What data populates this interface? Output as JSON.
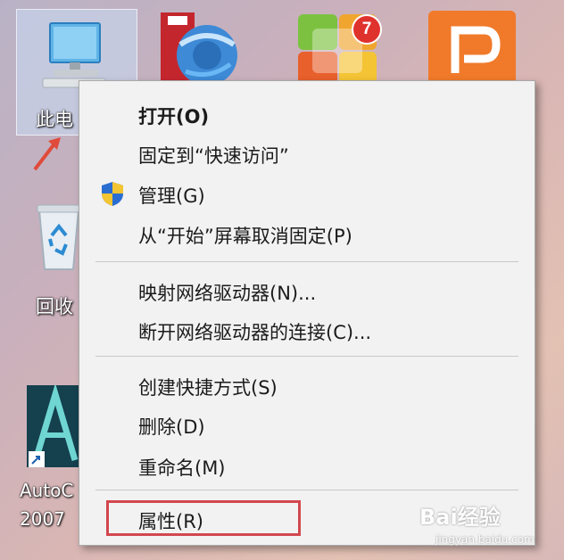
{
  "desktop": {
    "icons": [
      {
        "name": "this-pc",
        "label": "此电"
      },
      {
        "name": "ie-browser",
        "label": ""
      },
      {
        "name": "app-store",
        "label": "",
        "badge": "7"
      },
      {
        "name": "wps-presentation",
        "label": ""
      },
      {
        "name": "recycle-bin",
        "label": "回收"
      },
      {
        "name": "autocad",
        "label_line1": "AutoC",
        "label_line2": "2007"
      }
    ]
  },
  "context_menu": {
    "items": [
      {
        "label": "打开(O)",
        "bold": true
      },
      {
        "label": "固定到“快速访问”"
      },
      {
        "label": "管理(G)",
        "icon": "uac-shield-icon"
      },
      {
        "label": "从“开始”屏幕取消固定(P)"
      },
      {
        "label": "映射网络驱动器(N)..."
      },
      {
        "label": "断开网络驱动器的连接(C)..."
      },
      {
        "label": "创建快捷方式(S)"
      },
      {
        "label": "删除(D)"
      },
      {
        "label": "重命名(M)"
      },
      {
        "label": "属性(R)"
      }
    ],
    "highlight_color": "#d2474e"
  },
  "watermark": {
    "text": "Bai经验",
    "sub": "jingyan.baidu.com"
  }
}
